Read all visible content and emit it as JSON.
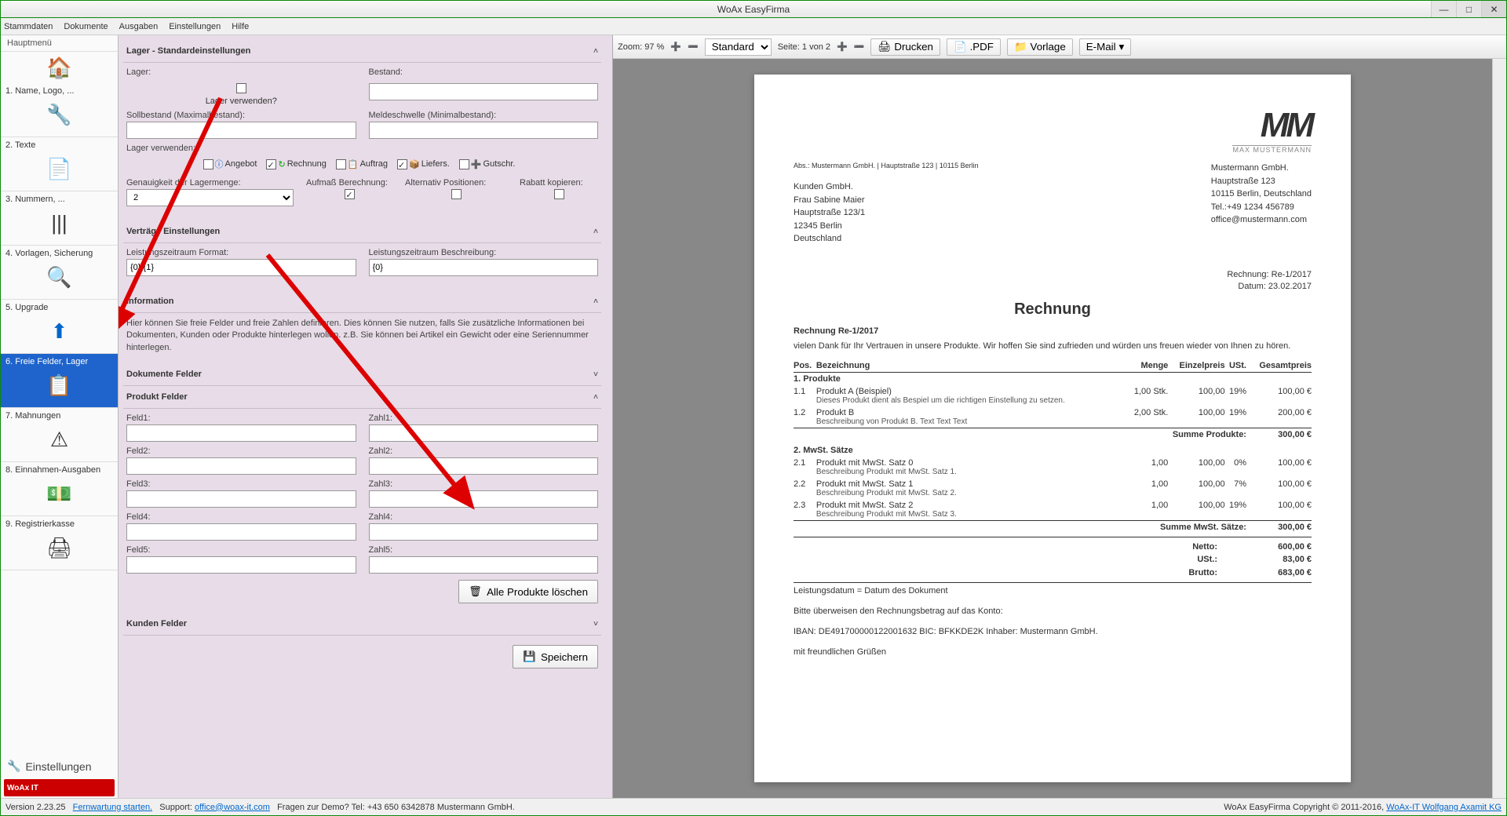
{
  "title": "WoAx EasyFirma",
  "menu": [
    "Stammdaten",
    "Dokumente",
    "Ausgaben",
    "Einstellungen",
    "Hilfe"
  ],
  "sidebar": {
    "header": "Hauptmenü",
    "items": [
      {
        "label": "1. Name, Logo, ...",
        "icon": "🔧"
      },
      {
        "label": "2. Texte",
        "icon": "📄"
      },
      {
        "label": "3. Nummern, ...",
        "icon": "|||"
      },
      {
        "label": "4. Vorlagen, Sicherung",
        "icon": "🔍"
      },
      {
        "label": "5. Upgrade",
        "icon": "⬆"
      },
      {
        "label": "6. Freie Felder, Lager",
        "icon": "📋"
      },
      {
        "label": "7. Mahnungen",
        "icon": "⚠"
      },
      {
        "label": "8. Einnahmen-Ausgaben",
        "icon": "💵"
      },
      {
        "label": "9. Registrierkasse",
        "icon": "🖨"
      }
    ],
    "footer": "Einstellungen",
    "logo": "WoAx IT"
  },
  "settings": {
    "lager_head": "Lager - Standardeinstellungen",
    "lager_label": "Lager:",
    "bestand_label": "Bestand:",
    "lager_verwenden": "Lager verwenden?",
    "sollbestand": "Sollbestand (Maximalbestand):",
    "meldeschwelle": "Meldeschwelle (Minimalbestand):",
    "lager_verwenden2": "Lager verwenden:",
    "doc_types": {
      "angebot": "Angebot",
      "rechnung": "Rechnung",
      "auftrag": "Auftrag",
      "liefers": "Liefers.",
      "gutschr": "Gutschr."
    },
    "genauigkeit": "Genauigkeit der Lagermenge:",
    "genauigkeit_val": "2",
    "aufmass": "Aufmaß Berechnung:",
    "alternativ": "Alternativ Positionen:",
    "rabatt": "Rabatt kopieren:",
    "vertraege_head": "Verträge Einstellungen",
    "lz_format": "Leistungszeitraum Format:",
    "lz_format_val": "{0} {1}",
    "lz_beschr": "Leistungszeitraum Beschreibung:",
    "lz_beschr_val": "{0}",
    "info_head": "Information",
    "info_text": "Hier können Sie freie Felder und freie Zahlen definieren. Dies können Sie nutzen, falls Sie zusätzliche Informationen bei Dokumenten, Kunden oder Produkte hinterlegen wollen. z.B. Sie können bei Artikel ein Gewicht oder eine Seriennummer hinterlegen.",
    "dok_felder": "Dokumente Felder",
    "prod_felder": "Produkt Felder",
    "feld": [
      "Feld1:",
      "Feld2:",
      "Feld3:",
      "Feld4:",
      "Feld5:"
    ],
    "zahl": [
      "Zahl1:",
      "Zahl2:",
      "Zahl3:",
      "Zahl4:",
      "Zahl5:"
    ],
    "alle_loeschen": "Alle Produkte löschen",
    "kunden_felder": "Kunden Felder",
    "speichern": "Speichern"
  },
  "toolbar": {
    "zoom": "Zoom: 97 %",
    "standard": "Standard",
    "seite": "Seite: 1 von 2",
    "drucken": "Drucken",
    "pdf": ".PDF",
    "vorlage": "Vorlage",
    "email": "E-Mail"
  },
  "invoice": {
    "logo_top": "MM",
    "logo_sub": "MAX MUSTERMANN",
    "company": {
      "name": "Mustermann GmbH.",
      "street": "Hauptstraße 123",
      "city": "10115 Berlin, Deutschland",
      "tel": "Tel.:+49 1234 456789",
      "email": "office@mustermann.com"
    },
    "abs": "Abs.: Mustermann GmbH. | Hauptstraße 123 | 10115 Berlin",
    "customer": {
      "name": "Kunden GmbH.",
      "person": "Frau Sabine Maier",
      "street": "Hauptstraße 123/1",
      "city": "12345 Berlin",
      "country": "Deutschland"
    },
    "meta": {
      "nr": "Rechnung: Re-1/2017",
      "date": "Datum: 23.02.2017"
    },
    "title": "Rechnung",
    "subtitle": "Rechnung Re-1/2017",
    "intro": "vielen Dank für Ihr Vertrauen in unsere Produkte. Wir hoffen Sie sind zufrieden und würden uns freuen wieder von Ihnen zu hören.",
    "th": {
      "pos": "Pos.",
      "bez": "Bezeichnung",
      "menge": "Menge",
      "preis": "Einzelpreis",
      "ust": "USt.",
      "gesamt": "Gesamtpreis"
    },
    "g1": "1. Produkte",
    "r1": {
      "pos": "1.1",
      "name": "Produkt A (Beispiel)",
      "desc": "Dieses Produkt dient als Bespiel um die richtigen Einstellung zu setzen.",
      "menge": "1,00 Stk.",
      "preis": "100,00",
      "ust": "19%",
      "gesamt": "100,00 €"
    },
    "r2": {
      "pos": "1.2",
      "name": "Produkt B",
      "desc": "Beschreibung von Produkt B. Text Text Text",
      "menge": "2,00 Stk.",
      "preis": "100,00",
      "ust": "19%",
      "gesamt": "200,00 €"
    },
    "sum1": {
      "label": "Summe Produkte:",
      "val": "300,00 €"
    },
    "g2": "2. MwSt. Sätze",
    "r3": {
      "pos": "2.1",
      "name": "Produkt mit MwSt. Satz 0",
      "desc": "Beschreibung Produkt mit MwSt. Satz 1.",
      "menge": "1,00",
      "preis": "100,00",
      "ust": "0%",
      "gesamt": "100,00 €"
    },
    "r4": {
      "pos": "2.2",
      "name": "Produkt mit MwSt. Satz 1",
      "desc": "Beschreibung Produkt mit MwSt. Satz 2.",
      "menge": "1,00",
      "preis": "100,00",
      "ust": "7%",
      "gesamt": "100,00 €"
    },
    "r5": {
      "pos": "2.3",
      "name": "Produkt mit MwSt. Satz 2",
      "desc": "Beschreibung Produkt mit MwSt. Satz 3.",
      "menge": "1,00",
      "preis": "100,00",
      "ust": "19%",
      "gesamt": "100,00 €"
    },
    "sum2": {
      "label": "Summe MwSt. Sätze:",
      "val": "300,00 €"
    },
    "totals": {
      "netto_l": "Netto:",
      "netto": "600,00 €",
      "ust_l": "USt.:",
      "ust": "83,00 €",
      "brutto_l": "Brutto:",
      "brutto": "683,00 €"
    },
    "leist": "Leistungsdatum = Datum des Dokument",
    "bitte": "Bitte überweisen den Rechnungsbetrag auf das Konto:",
    "iban": "IBAN: DE491700000122001632 BIC: BFKKDE2K Inhaber: Mustermann GmbH.",
    "gruss": "mit freundlichen Grüßen"
  },
  "status": {
    "version": "Version 2.23.25",
    "fern": "Fernwartung starten.",
    "support": "Support:",
    "email": "office@woax-it.com",
    "fragen": "Fragen zur Demo? Tel: +43 650 6342878 Mustermann GmbH.",
    "copy": "WoAx EasyFirma Copyright © 2011-2016,",
    "link": "WoAx-IT Wolfgang Axamit KG"
  }
}
